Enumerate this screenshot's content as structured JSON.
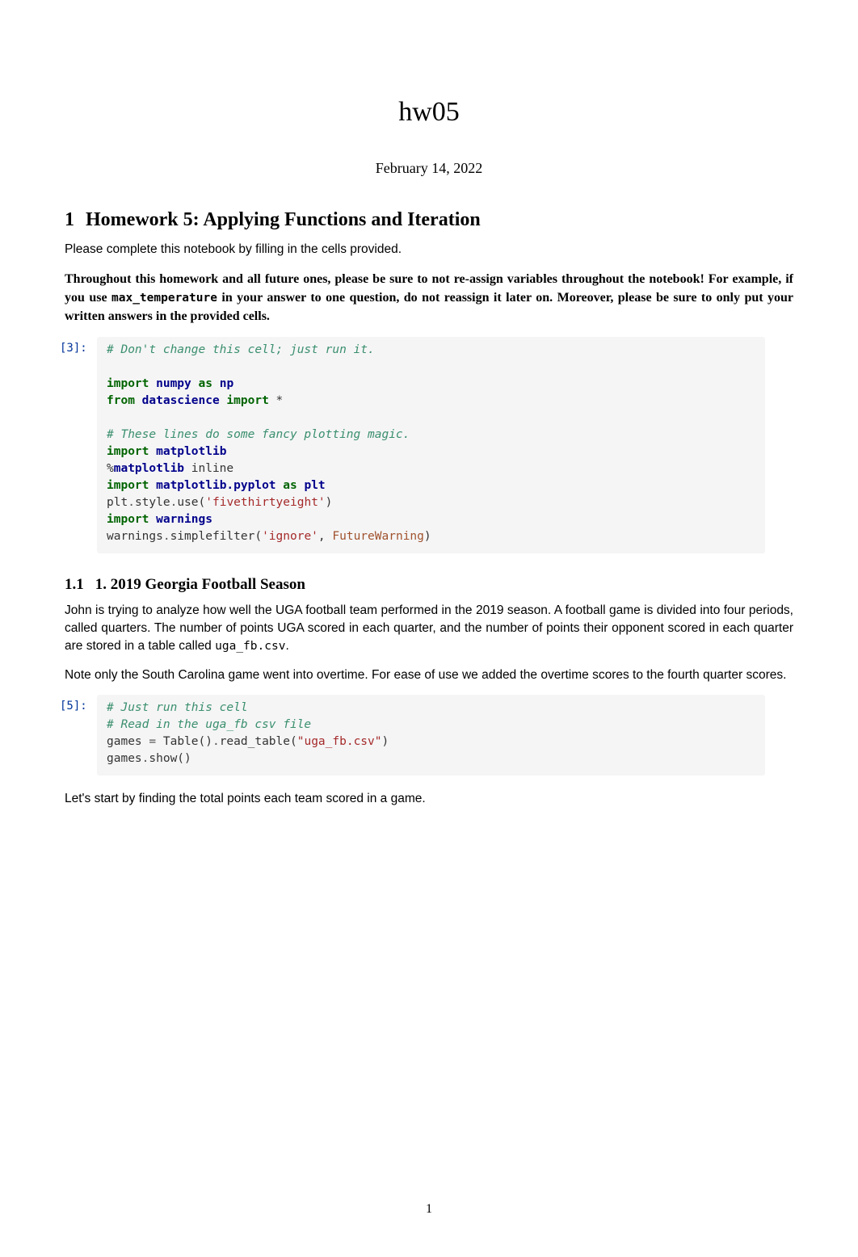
{
  "title": "hw05",
  "date": "February 14, 2022",
  "section1": {
    "number": "1",
    "title": "Homework 5: Applying Functions and Iteration"
  },
  "intro_plain": "Please complete this notebook by filling in the cells provided.",
  "intro_bold_1": "Throughout this homework and all future ones, please be sure to not re-assign variables throughout the notebook! For example, if you use ",
  "intro_code": "max_temperature",
  "intro_bold_2": " in your answer to one question, do not reassign it later on. Moreover, please be sure to only put your written answers in the provided cells.",
  "code1": {
    "prompt": "[3]:",
    "l1": "# Don't change this cell; just run it.",
    "l2": "import",
    "l2b": " numpy",
    "l2c": " as",
    "l2d": " np",
    "l3a": "from",
    "l3b": " datascience",
    "l3c": " import",
    "l3d": " *",
    "l4": "# These lines do some fancy plotting magic.",
    "l5a": "import",
    "l5b": " matplotlib",
    "l6a": "%",
    "l6b": "matplotlib ",
    "l6c": "inline",
    "l7a": "import",
    "l7b": " matplotlib.pyplot",
    "l7c": " as",
    "l7d": " plt",
    "l8a": "plt",
    "l8b": ".",
    "l8c": "style",
    "l8d": ".",
    "l8e": "use(",
    "l8f": "'fivethirtyeight'",
    "l8g": ")",
    "l9a": "import",
    "l9b": " warnings",
    "l10a": "warnings",
    "l10b": ".",
    "l10c": "simplefilter(",
    "l10d": "'ignore'",
    "l10e": ", ",
    "l10f": "FutureWarning",
    "l10g": ")"
  },
  "subsection1": {
    "number": "1.1",
    "title": "1. 2019 Georgia Football Season"
  },
  "para1a": "John is trying to analyze how well the UGA football team performed in the 2019 season. A football game is divided into four periods, called quarters.    The number of points UGA scored in each quarter, and the number of points their opponent scored in each quarter are stored in a table called ",
  "para1_code": "uga_fb.csv",
  "para1b": ".",
  "para2": "Note only the South Carolina game went into overtime.     For ease of use we added the overtime scores to the fourth quarter scores.",
  "code2": {
    "prompt": "[5]:",
    "l1": "# Just run this cell",
    "l2": "# Read in the uga_fb csv file",
    "l3a": "games ",
    "l3b": "=",
    "l3c": " Table()",
    "l3d": ".",
    "l3e": "read_table(",
    "l3f": "\"uga_fb.csv\"",
    "l3g": ")",
    "l4a": "games",
    "l4b": ".",
    "l4c": "show()"
  },
  "para3": "Let's start by finding the total points each team scored in a game.",
  "page_number": "1"
}
